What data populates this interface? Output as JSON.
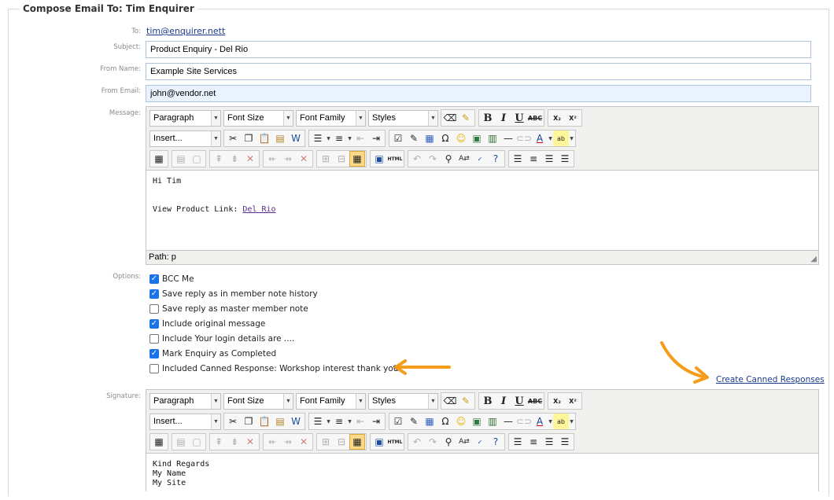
{
  "legend": "Compose Email To: Tim Enquirer",
  "labels": {
    "to": "To:",
    "subject": "Subject:",
    "from_name": "From Name:",
    "from_email": "From Email:",
    "message": "Message:",
    "options": "Options:",
    "signature": "Signature:"
  },
  "to_value": "tim@enquirer.nett",
  "subject_value": "Product Enquiry - Del Rio",
  "from_name_value": "Example Site Services",
  "from_email_value": "john@vendor.net",
  "toolbar": {
    "format": "Paragraph",
    "font_size": "Font Size",
    "font_family": "Font Family",
    "styles": "Styles",
    "insert": "Insert...",
    "bold": "B",
    "italic": "I",
    "underline": "U",
    "strike": "ABC",
    "sub": "X₂",
    "sup": "X²",
    "html": "HTML"
  },
  "message": {
    "line1": "Hi Tim",
    "link_prefix": "View Product Link: ",
    "link_text": "Del Rio",
    "path": "Path: p"
  },
  "options": [
    {
      "label": "BCC Me",
      "checked": true
    },
    {
      "label": "Save reply as in member note history",
      "checked": true
    },
    {
      "label": "Save reply as master member note",
      "checked": false
    },
    {
      "label": "Include original message",
      "checked": true
    },
    {
      "label": "Include Your login details are ....",
      "checked": false
    },
    {
      "label": "Mark Enquiry as Completed",
      "checked": true
    },
    {
      "label": "Included Canned Response: Workshop interest thank you",
      "checked": false
    }
  ],
  "create_canned": "Create Canned Responses",
  "signature": {
    "line1": "Kind Regards",
    "line2": "My Name",
    "line3": "My Site"
  },
  "colors": {
    "accent_arrow": "#f59c1a",
    "field_border": "#aac4dd",
    "checkbox": "#1a73e8"
  }
}
